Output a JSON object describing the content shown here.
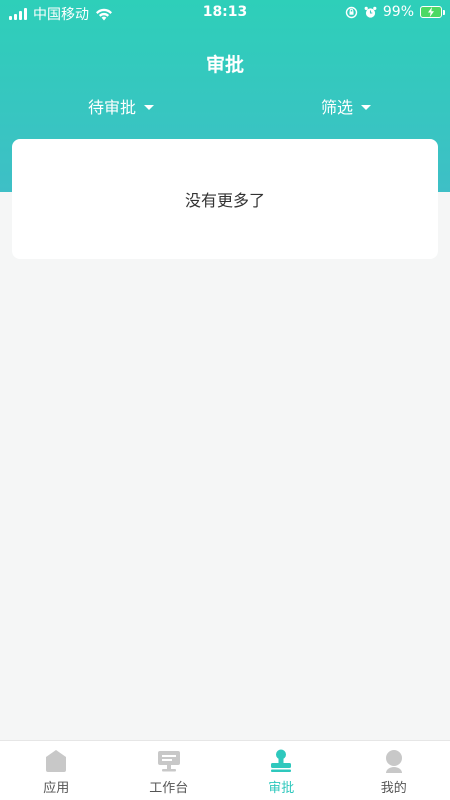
{
  "status_bar": {
    "carrier": "中国移动",
    "time": "18:13",
    "battery": "99%"
  },
  "header": {
    "title": "审批",
    "filter_status": "待审批",
    "filter_label": "筛选"
  },
  "list": {
    "empty_text": "没有更多了"
  },
  "tabbar": {
    "items": [
      {
        "label": "应用",
        "icon": "home-icon",
        "active": false
      },
      {
        "label": "工作台",
        "icon": "monitor-icon",
        "active": false
      },
      {
        "label": "审批",
        "icon": "stamp-icon",
        "active": true
      },
      {
        "label": "我的",
        "icon": "user-icon",
        "active": false
      }
    ]
  },
  "colors": {
    "accent": "#2ec8bd",
    "header_top": "#2ecfb9",
    "header_bottom": "#3ebfc6",
    "inactive_icon": "#c8c8c8",
    "battery_fill": "#4cd964"
  }
}
